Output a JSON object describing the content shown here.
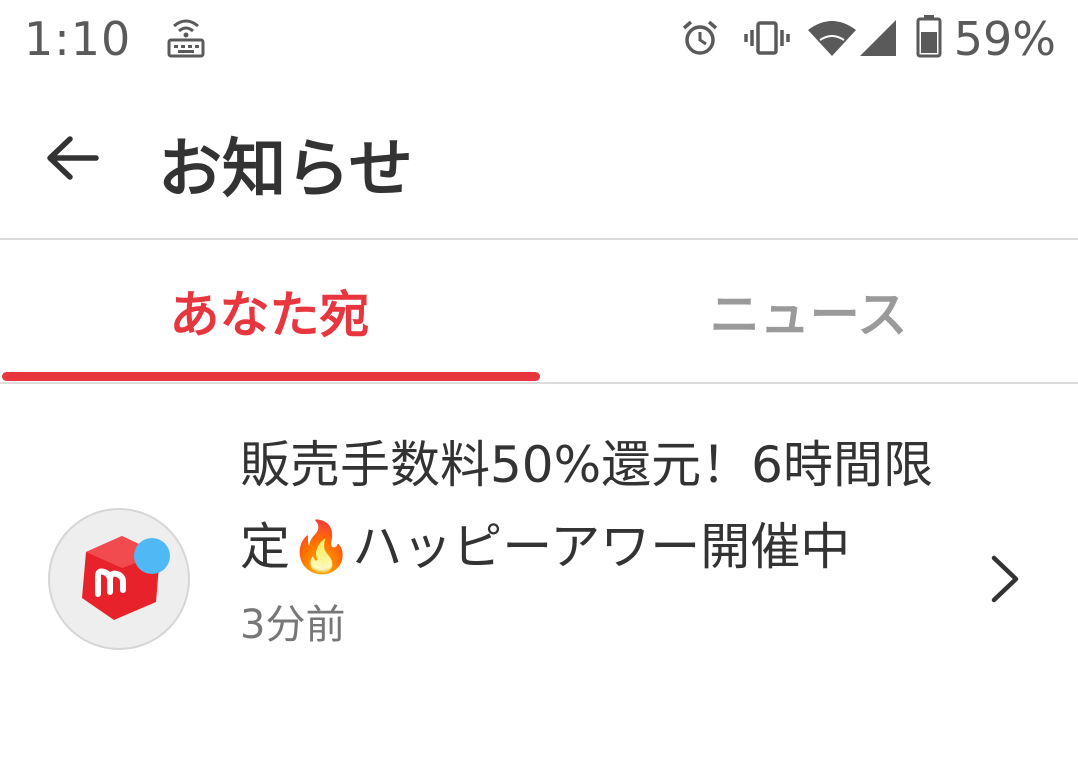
{
  "status_bar": {
    "time": "1:10",
    "battery": "59%",
    "icons": [
      "keyboard-wifi-icon",
      "alarm-icon",
      "vibrate-icon",
      "wifi-icon",
      "signal-icon",
      "battery-icon"
    ]
  },
  "app_bar": {
    "back_icon": "arrow-left-icon",
    "title": "お知らせ"
  },
  "tabs": [
    {
      "label": "あなた宛",
      "active": true
    },
    {
      "label": "ニュース",
      "active": false
    }
  ],
  "colors": {
    "accent": "#e8363f",
    "inactive_tab": "#9a9a9a",
    "badge_dot": "#4fb8f5"
  },
  "notifications": [
    {
      "icon": "mercari-logo-icon",
      "title": "販売手数料50%還元！6時間限定🔥ハッピーアワー開催中",
      "time": "3分前",
      "chevron": "chevron-right-icon",
      "unread": true
    }
  ]
}
